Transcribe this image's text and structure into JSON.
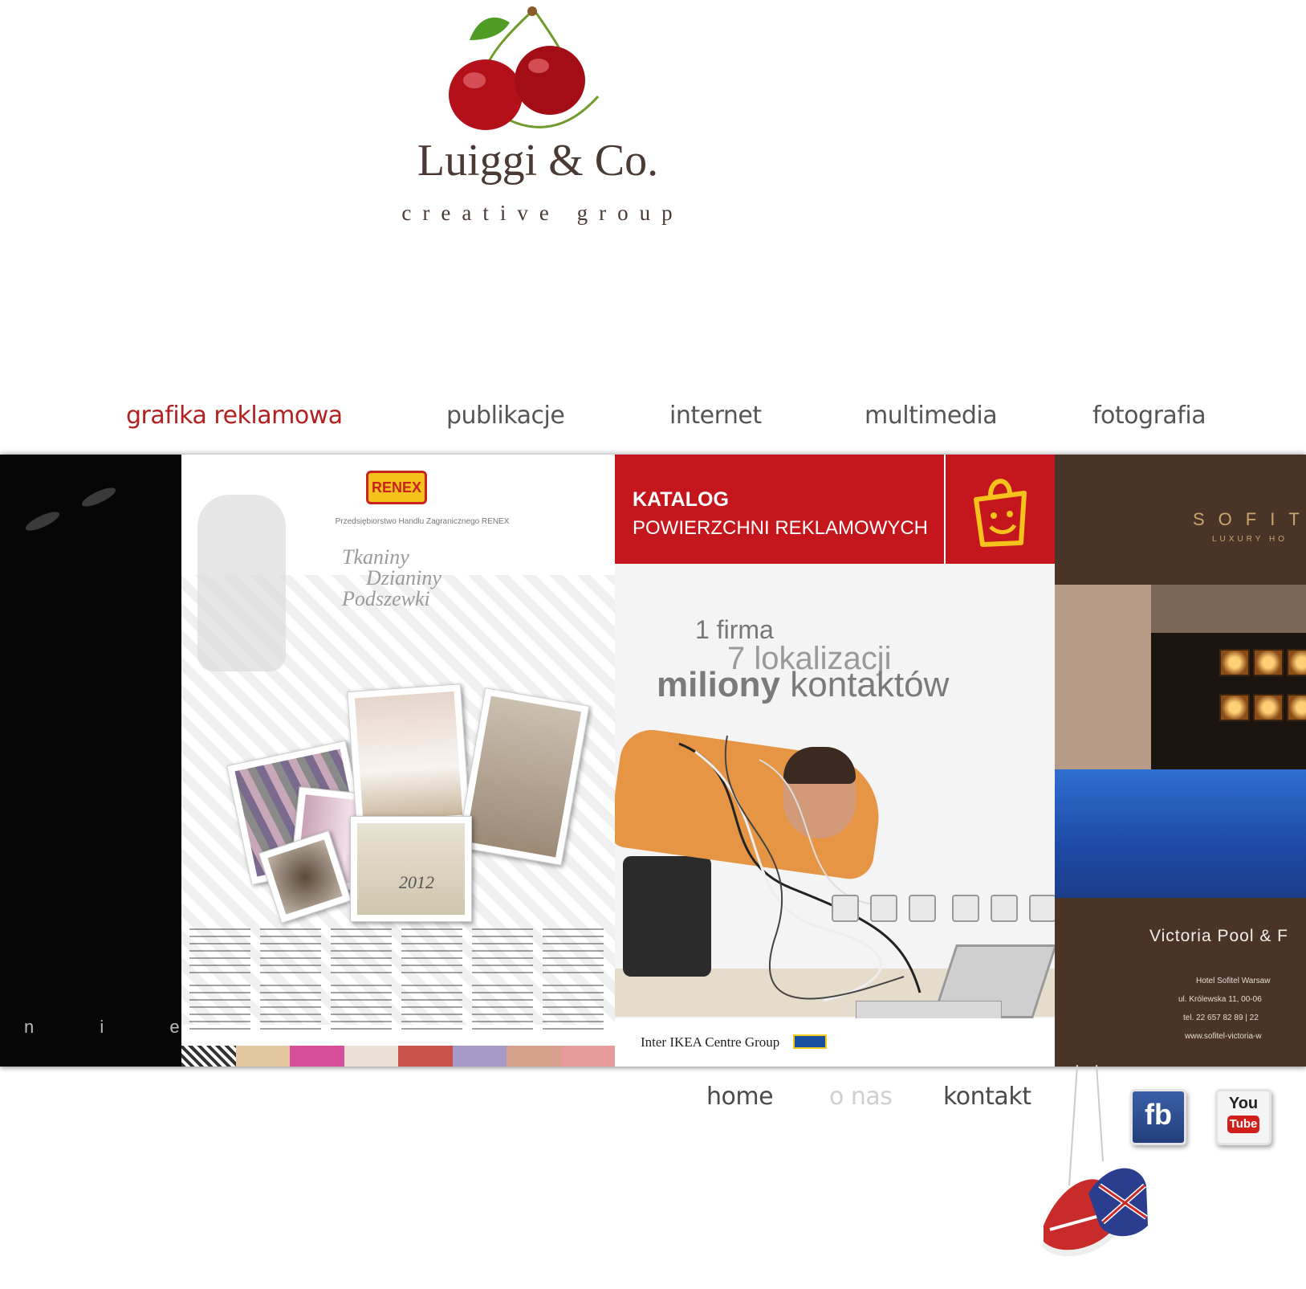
{
  "brand": {
    "name": "Luiggi & Co.",
    "tagline": "creative group"
  },
  "top_nav": {
    "items": [
      {
        "label": "grafika reklamowa",
        "active": true
      },
      {
        "label": "publikacje",
        "active": false
      },
      {
        "label": "internet",
        "active": false
      },
      {
        "label": "multimedia",
        "active": false
      },
      {
        "label": "fotografia",
        "active": false
      }
    ],
    "active_color": "#b3201f",
    "inactive_color": "#555555"
  },
  "gallery": {
    "panel_dark": {
      "letters": "n i e"
    },
    "panel_renex": {
      "logo": "RENEX",
      "company_line": "Przedsiębiorstwo Handlu Zagranicznego RENEX",
      "script_lines": [
        "Tkaniny",
        "Dzianiny",
        "Podszewki"
      ],
      "year": "2012"
    },
    "panel_ikea": {
      "title": "KATALOG",
      "subtitle": "POWIERZCHNI REKLAMOWYCH",
      "line1": "1 firma",
      "line2": "7 lokalizacji",
      "line3_bold": "miliony",
      "line3_rest": "kontaktów",
      "footer": "Inter IKEA Centre Group",
      "accent_color": "#c4161c"
    },
    "panel_sofitel": {
      "logo": "SOFIT",
      "logo_sub": "LUXURY HO",
      "title": "Victoria Pool & F",
      "address": [
        "Hotel Sofitel Warsaw",
        "ul. Królewska 11, 00-06",
        "tel. 22 657 82 89 | 22",
        "www.sofitel-victoria-w"
      ]
    }
  },
  "bottom_nav": {
    "items": [
      {
        "label": "home",
        "dimmed": false
      },
      {
        "label": "o nas",
        "dimmed": true
      },
      {
        "label": "kontakt",
        "dimmed": false
      }
    ]
  },
  "social": {
    "facebook_label": "fb",
    "youtube_label_top": "You",
    "youtube_label_bottom": "Tube"
  }
}
